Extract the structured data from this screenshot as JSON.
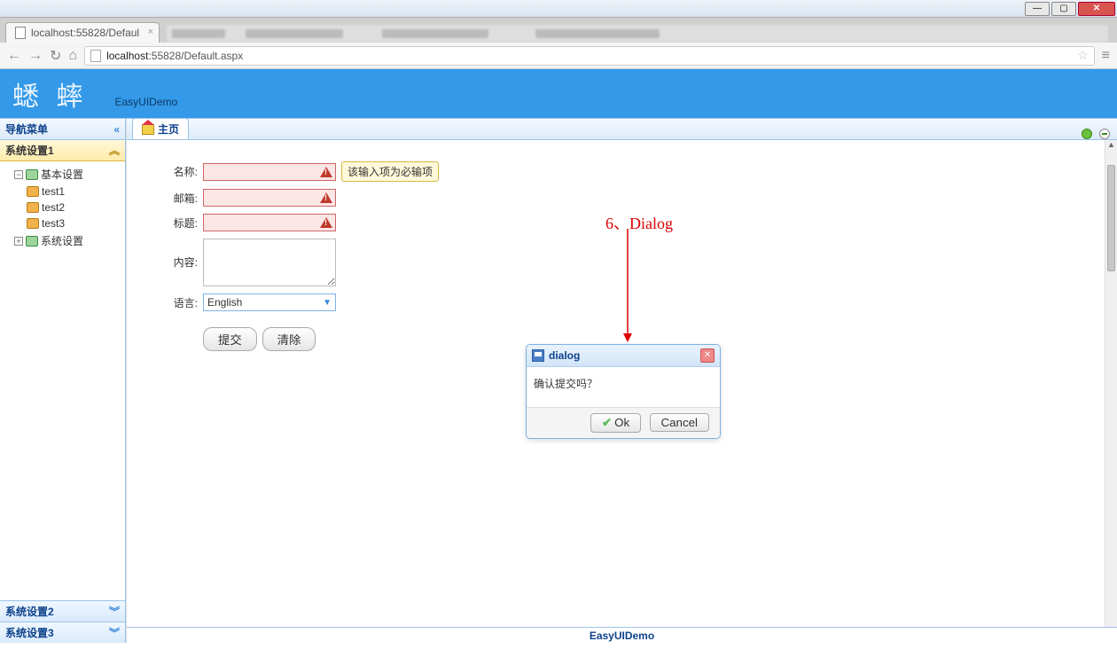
{
  "browser": {
    "tab_title": "localhost:55828/Defaul",
    "url_host": "localhost",
    "url_rest": ":55828/Default.aspx"
  },
  "header": {
    "logo_text": "蟋 蟀",
    "brand": "EasyUIDemo"
  },
  "sidebar": {
    "title": "导航菜单",
    "sections": [
      {
        "label": "系统设置1",
        "active": true
      },
      {
        "label": "系统设置2",
        "active": false
      },
      {
        "label": "系统设置3",
        "active": false
      }
    ],
    "tree": {
      "root": "基本设置",
      "children": [
        "test1",
        "test2",
        "test3"
      ],
      "sibling": "系统设置"
    }
  },
  "main_tab": "主页",
  "form": {
    "name_label": "名称:",
    "email_label": "邮箱:",
    "title_label": "标题:",
    "content_label": "内容:",
    "lang_label": "语言:",
    "lang_value": "English",
    "required_tip": "该输入项为必输项",
    "submit": "提交",
    "clear": "清除"
  },
  "annotation": "6、Dialog",
  "dialog": {
    "title": "dialog",
    "body": "确认提交吗？",
    "ok": "Ok",
    "cancel": "Cancel"
  },
  "footer": "EasyUIDemo"
}
